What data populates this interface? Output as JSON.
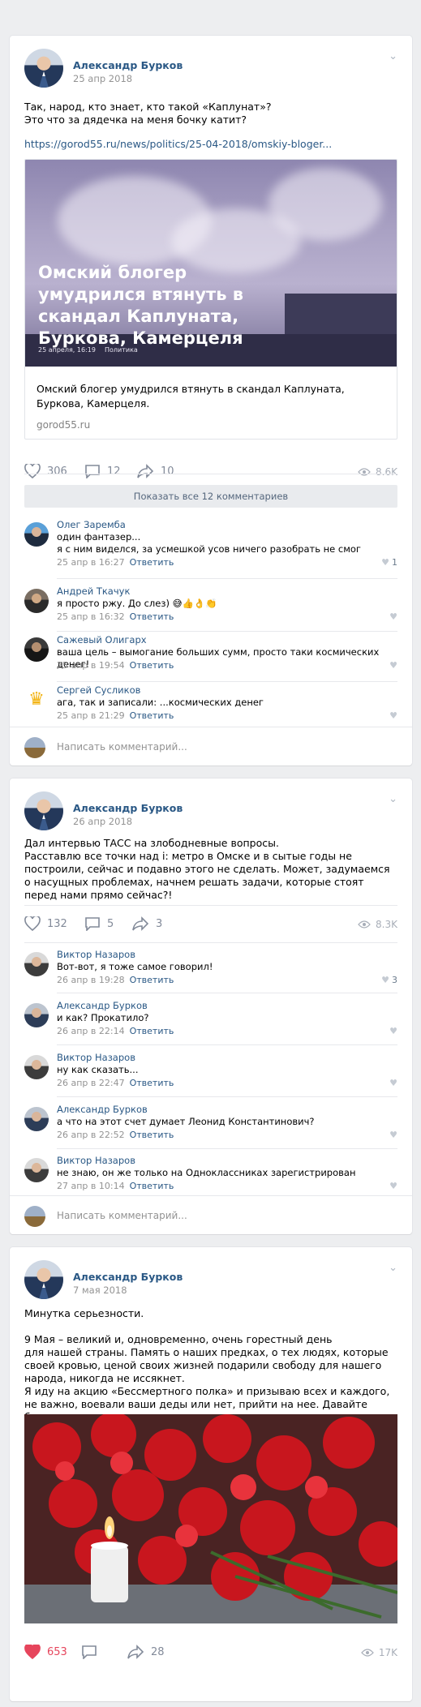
{
  "post1": {
    "author": "Александр Бурков",
    "date": "25 апр 2018",
    "text": "Так, народ, кто знает, кто такой «Каплунат»?\nЭто что за дядечка на меня бочку катит?",
    "link": "https://gorod55.ru/news/politics/25-04-2018/omskiy-bloger...",
    "card": {
      "title": "Омский блогер умудрился втянуть в скандал Каплуната, Буркова, Камерцеля",
      "meta": "25 апреля, 16:19",
      "category": "Политика",
      "text": "Омский блогер умудрился втянуть в скандал Каплуната, Буркова, Камерцеля.",
      "domain": "gorod55.ru"
    },
    "likes": "306",
    "comments": "12",
    "shares": "10",
    "views": "8.6K",
    "show_all": "Показать все 12 комментариев",
    "comments_list": [
      {
        "name": "Олег Заремба",
        "text": "один фантазер...\nя с ним виделся, за усмешкой усов ничего разобрать не смог",
        "date": "25 апр в 16:27",
        "reply": "Ответить",
        "likes": "1"
      },
      {
        "name": "Андрей Ткачук",
        "text": "я просто ржу. До слез) 😅👍👌👏",
        "date": "25 апр в 16:32",
        "reply": "Ответить",
        "likes": ""
      },
      {
        "name": "Сажевый Олигарх",
        "text": "ваша цель – вымогание больших сумм, просто таки космических денег!",
        "date": "25 апр в 19:54",
        "reply": "Ответить",
        "likes": ""
      },
      {
        "name": "Сергей Сусликов",
        "text": "ага, так и записали: ...космических денег",
        "date": "25 апр в 21:29",
        "reply": "Ответить",
        "likes": ""
      }
    ],
    "write_placeholder": "Написать комментарий..."
  },
  "post2": {
    "author": "Александр Бурков",
    "date": "26 апр 2018",
    "text": "Дал интервью ТАСС на злободневные вопросы.\nРасставлю все точки над i: метро в Омске и в сытые годы не построили, сейчас и подавно этого не сделать. Может, задумаемся о насущных проблемах, начнем решать задачи, которые стоят перед нами прямо сейчас?!",
    "likes": "132",
    "comments": "5",
    "shares": "3",
    "views": "8.3K",
    "comments_list": [
      {
        "name": "Виктор Назаров",
        "text": "Вот-вот, я тоже самое говорил!",
        "date": "26 апр в 19:28",
        "reply": "Ответить",
        "likes": "3"
      },
      {
        "name": "Александр Бурков",
        "text": "и как? Прокатило?",
        "date": "26 апр в 22:14",
        "reply": "Ответить",
        "likes": ""
      },
      {
        "name": "Виктор Назаров",
        "text": "ну как сказать...",
        "date": "26 апр в 22:47",
        "reply": "Ответить",
        "likes": ""
      },
      {
        "name": "Александр Бурков",
        "text": "а что на этот счет думает Леонид Константинович?",
        "date": "26 апр в 22:52",
        "reply": "Ответить",
        "likes": ""
      },
      {
        "name": "Виктор Назаров",
        "text": "не знаю, он же только на Одноклассниках зарегистрирован",
        "date": "27 апр в 10:14",
        "reply": "Ответить",
        "likes": ""
      }
    ],
    "write_placeholder": "Написать комментарий..."
  },
  "post3": {
    "author": "Александр Бурков",
    "date": "7 мая 2018",
    "text": "Минутка серьезности.\n\n9 Мая – великий и, одновременно, очень горестный день\nдля нашей страны. Память о наших предках, о тех людях, которые своей кровью, ценой своих жизней подарили свободу для нашего народа, никогда не иссякнет.\nЯ иду на акцию «Бессмертного полка» и призываю всех и каждого, не важно, воевали ваши деды или нет, прийти на нее. Давайте будем помнить вместе.",
    "likes": "653",
    "comments": "",
    "shares": "28",
    "views": "17K"
  },
  "colors": {
    "link": "#2a5885",
    "liked": "#e6455c",
    "muted": "#828a99"
  }
}
